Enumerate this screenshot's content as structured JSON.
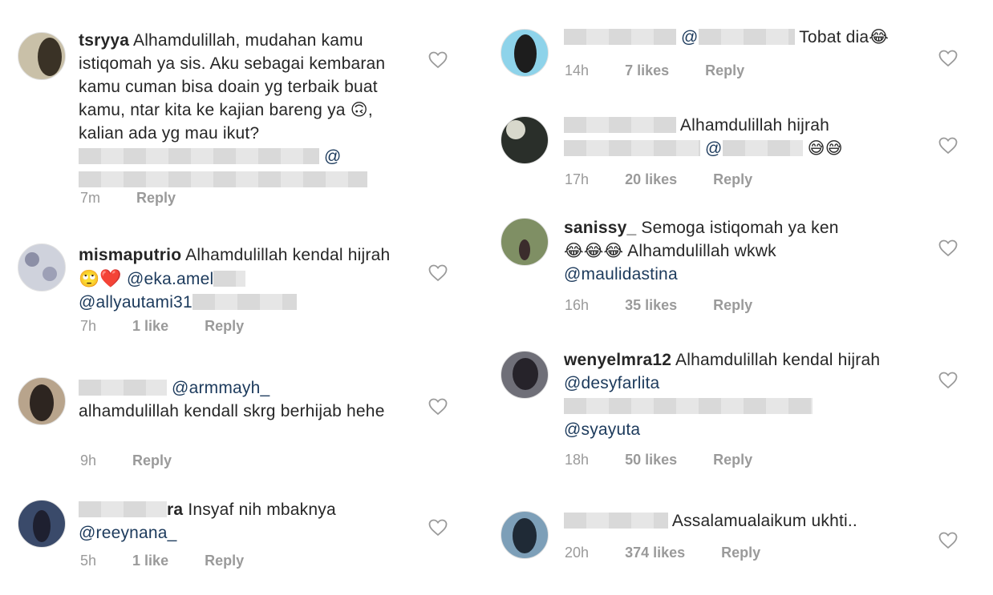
{
  "left": [
    {
      "username": "tsryya",
      "text_before": "Alhamdulillah, mudahan kamu istiqomah ya sis. Aku sebagai kembaran kamu cuman bisa doain yg terbaik buat kamu, ntar kita ke kajian bareng ya ",
      "emoji": "🙃",
      "text_after": ", kalian ada yg mau ikut?",
      "mention": "@",
      "time": "7m",
      "likes": "",
      "reply": "Reply"
    },
    {
      "username": "mismaputrio",
      "text_before": "Alhamdulillah kendal hijrah",
      "emoji": "🙄",
      "heart": "❤️",
      "mention": "@eka.amel",
      "mention2": "@allyautami31",
      "time": "7h",
      "likes": "1 like",
      "reply": "Reply"
    },
    {
      "username": "",
      "mention": "@armmayh_",
      "text_before": "alhamdulillah kendall skrg berhijab hehe",
      "time": "9h",
      "likes": "",
      "reply": "Reply"
    },
    {
      "username": "ra",
      "text_before": "Insyaf nih mbaknya",
      "mention": "@reeynana_",
      "time": "5h",
      "likes": "1 like",
      "reply": "Reply"
    }
  ],
  "right": [
    {
      "username": "",
      "mention": "@",
      "text_before": "Tobat dia",
      "emoji": "😂",
      "time": "14h",
      "likes": "7 likes",
      "reply": "Reply"
    },
    {
      "username": "",
      "text_before": "Alhamdulillah hijrah",
      "mention": "@",
      "emoji": "😅",
      "time": "17h",
      "likes": "20 likes",
      "reply": "Reply"
    },
    {
      "username": "sanissy_",
      "text_before": "Semoga istiqomah ya ken",
      "emoji": "😂",
      "text_after": "Alhamdulillah wkwk",
      "mention": "@maulidastina",
      "time": "16h",
      "likes": "35 likes",
      "reply": "Reply"
    },
    {
      "username": "wenyelmra12",
      "text_before": "Alhamdulillah kendal hijrah",
      "mention": "@desyfarlita",
      "mention2": "@syayuta",
      "time": "18h",
      "likes": "50 likes",
      "reply": "Reply"
    },
    {
      "username": "",
      "text_before": "Assalamualaikum ukhti..",
      "time": "20h",
      "likes": "374 likes",
      "reply": "Reply"
    }
  ],
  "icons": {
    "like": "heart-outline-icon"
  },
  "colors": {
    "text": "#262626",
    "meta": "#9a9a9a",
    "mention": "#1c3a5c"
  }
}
